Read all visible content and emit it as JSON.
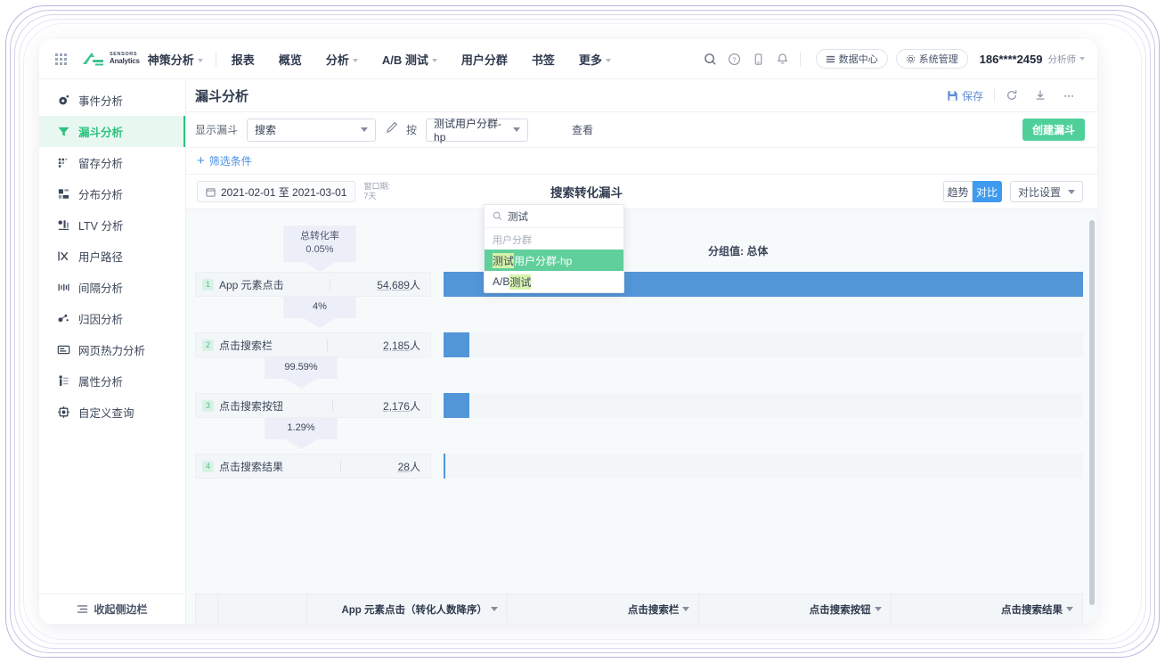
{
  "topnav": {
    "grid_icon": "apps-grid-icon",
    "logo_line1": "SENSORS",
    "logo_line2": "Analytics",
    "brand": "神策分析",
    "nav_items": [
      {
        "label": "报表",
        "caret": false
      },
      {
        "label": "概览",
        "caret": false
      },
      {
        "label": "分析",
        "caret": true
      },
      {
        "label": "A/B 测试",
        "caret": true
      },
      {
        "label": "用户分群",
        "caret": false
      },
      {
        "label": "书签",
        "caret": false
      },
      {
        "label": "更多",
        "caret": true
      }
    ],
    "icons": [
      "search-icon",
      "help-icon",
      "mobile-icon",
      "bell-icon"
    ],
    "data_center": "数据中心",
    "system_admin": "系统管理",
    "phone": "186****2459",
    "role": "分析师"
  },
  "sidebar": {
    "items": [
      {
        "label": "事件分析",
        "icon": "event-analysis-icon",
        "active": false
      },
      {
        "label": "漏斗分析",
        "icon": "funnel-analysis-icon",
        "active": true
      },
      {
        "label": "留存分析",
        "icon": "retention-analysis-icon",
        "active": false
      },
      {
        "label": "分布分析",
        "icon": "distribution-analysis-icon",
        "active": false
      },
      {
        "label": "LTV 分析",
        "icon": "ltv-analysis-icon",
        "active": false
      },
      {
        "label": "用户路径",
        "icon": "user-path-icon",
        "active": false
      },
      {
        "label": "间隔分析",
        "icon": "interval-analysis-icon",
        "active": false
      },
      {
        "label": "归因分析",
        "icon": "attribution-analysis-icon",
        "active": false
      },
      {
        "label": "网页热力分析",
        "icon": "heatmap-analysis-icon",
        "active": false
      },
      {
        "label": "属性分析",
        "icon": "attribute-analysis-icon",
        "active": false
      },
      {
        "label": "自定义查询",
        "icon": "custom-query-icon",
        "active": false
      }
    ],
    "collapse": "收起侧边栏"
  },
  "page": {
    "title": "漏斗分析",
    "save": "保存",
    "refresh_icon": "refresh-icon",
    "download_icon": "download-icon",
    "more_icon": "more-horizontal-icon"
  },
  "filter": {
    "show_funnel_label": "显示漏斗",
    "funnel_value": "搜索",
    "edit_icon": "pencil-icon",
    "by_label": "按",
    "group_value": "测试用户分群-hp",
    "view_label": "查看",
    "create_funnel": "创建漏斗",
    "condition": "筛选条件"
  },
  "dropdown": {
    "search_value": "测试",
    "search_icon": "search-icon",
    "group_header": "用户分群",
    "items": [
      {
        "pre": "",
        "mark": "测试",
        "post": "用户分群-hp",
        "selected": true
      },
      {
        "pre": "A/B ",
        "mark": "测试",
        "post": "",
        "selected": false
      }
    ]
  },
  "daterow": {
    "calendar_icon": "calendar-icon",
    "range": "2021-02-01 至 2021-03-01",
    "window_label": "窗口期:",
    "window_value": "7天",
    "funnel_name": "搜索转化漏斗",
    "seg_trend": "趋势",
    "seg_compare": "对比",
    "compare_settings": "对比设置"
  },
  "chart_data": {
    "type": "bar",
    "title": "搜索转化漏斗",
    "group_label": "分组值: 总体",
    "total_conv_label": "总转化率",
    "total_conv_value": "0.05%",
    "unit": "人",
    "steps": [
      {
        "index": "1",
        "name": "App 元素点击",
        "count": "54,689",
        "value": 54689
      },
      {
        "index": "2",
        "name": "点击搜索栏",
        "count": "2,185",
        "value": 2185
      },
      {
        "index": "3",
        "name": "点击搜索按钮",
        "count": "2,176",
        "value": 2176
      },
      {
        "index": "4",
        "name": "点击搜索结果",
        "count": "28",
        "value": 28
      }
    ],
    "step_conversions": [
      "4%",
      "99.59%",
      "1.29%"
    ],
    "bar_color": "#5296d8",
    "xlabel": "",
    "ylabel": "",
    "grid": false
  },
  "table": {
    "columns": [
      "",
      "",
      "App 元素点击（转化人数降序）",
      "点击搜索栏",
      "点击搜索按钮",
      "点击搜索结果"
    ]
  },
  "colors": {
    "accent_green": "#2ec27e",
    "accent_blue": "#3e9bf0",
    "bar_blue": "#5296d8",
    "button_green": "#4fd09b"
  }
}
